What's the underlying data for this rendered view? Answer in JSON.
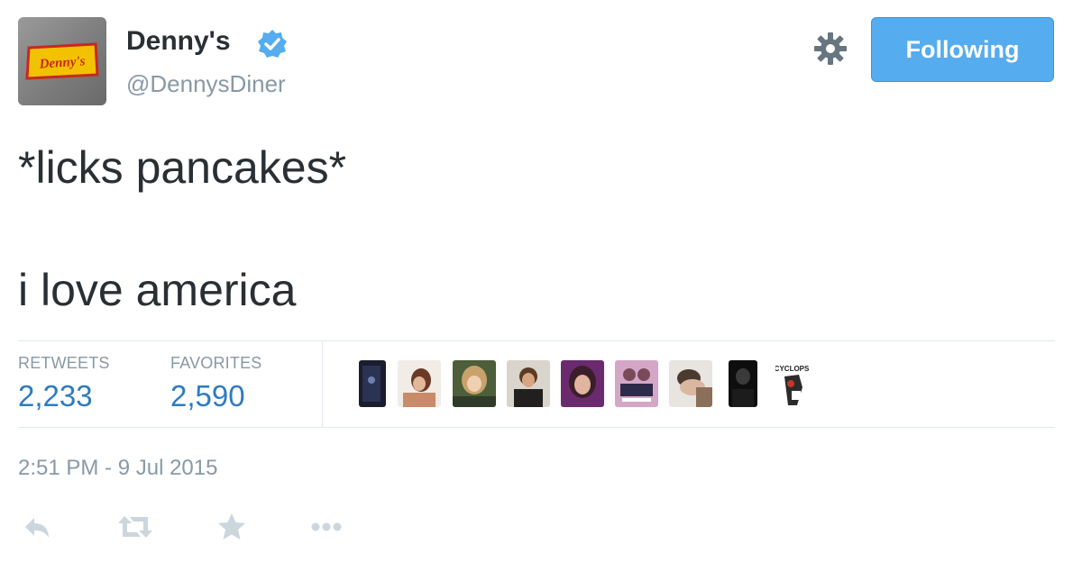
{
  "account": {
    "display_name": "Denny's",
    "screen_name": "@DennysDiner",
    "avatar_logo_text": "Denny's",
    "verified": true
  },
  "header": {
    "follow_button_label": "Following",
    "settings_icon": "gear-icon"
  },
  "tweet": {
    "lines": [
      "*licks pancakes*",
      "",
      "i love america"
    ]
  },
  "stats": {
    "retweets_label": "RETWEETS",
    "retweets_count": "2,233",
    "favorites_label": "FAVORITES",
    "favorites_count": "2,590"
  },
  "favoriters": {
    "count": 9,
    "last_avatar_text": "CYCLOPS"
  },
  "timestamp": "2:51 PM - 9 Jul 2015",
  "actions": [
    {
      "name": "reply-icon"
    },
    {
      "name": "retweet-icon"
    },
    {
      "name": "favorite-star-icon"
    },
    {
      "name": "more-dots-icon"
    }
  ],
  "colors": {
    "accent_blue": "#55acee",
    "link_blue": "#2e7bbf",
    "muted_gray": "#8899a6",
    "text_dark": "#292f33",
    "divider": "#e1e8ed",
    "verified_blue": "#55acee",
    "action_icon_gray": "#ccd6dd"
  }
}
